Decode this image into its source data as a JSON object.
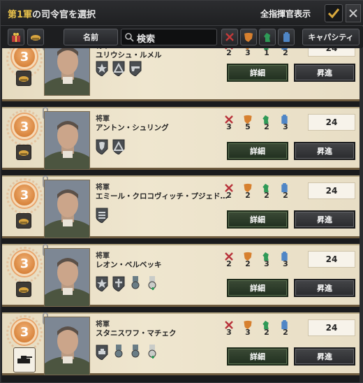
{
  "header": {
    "title_army": "第1軍",
    "title_rest": "の司令官を選択",
    "show_all_label": "全指揮官表示"
  },
  "toolbar": {
    "name_label": "名前",
    "search_placeholder": "検索",
    "capacity_label": "キャパシティ"
  },
  "colors": {
    "attack": "#b8323a",
    "defense": "#d7802f",
    "planning": "#2f9a57",
    "logistics": "#4f86c6",
    "accent": "#e8c14b"
  },
  "commanders": [
    {
      "skill": "3",
      "rank": "将軍",
      "name": "ユリウシュ・ルメル",
      "attack": "2",
      "defense": "3",
      "planning": "1",
      "logistics": "2",
      "capacity": "24",
      "detail": "詳細",
      "promote": "昇進",
      "traits": [
        "star-trait-icon",
        "mountain-trait-icon",
        "gun-trait-icon"
      ]
    },
    {
      "skill": "3",
      "rank": "将軍",
      "name": "アントン・シュリング",
      "attack": "3",
      "defense": "5",
      "planning": "2",
      "logistics": "3",
      "capacity": "24",
      "detail": "詳細",
      "promote": "昇進",
      "traits": [
        "shield-trait-icon",
        "mountain-trait-icon"
      ]
    },
    {
      "skill": "3",
      "rank": "将軍",
      "name": "エミール・クロコヴィッチ・プジェド…",
      "attack": "2",
      "defense": "2",
      "planning": "2",
      "logistics": "2",
      "capacity": "24",
      "detail": "詳細",
      "promote": "昇進",
      "traits": [
        "stripes-trait-icon"
      ]
    },
    {
      "skill": "3",
      "rank": "将軍",
      "name": "レオン・ベルベッキ",
      "attack": "2",
      "defense": "2",
      "planning": "3",
      "logistics": "3",
      "capacity": "24",
      "detail": "詳細",
      "promote": "昇進",
      "traits": [
        "star-trait-icon",
        "cross-trait-icon",
        "medal-trait-icon",
        "medal-add-icon"
      ]
    },
    {
      "skill": "3",
      "rank": "将軍",
      "name": "スタニスワフ・マチェク",
      "attack": "3",
      "defense": "3",
      "planning": "2",
      "logistics": "2",
      "capacity": "24",
      "detail": "詳細",
      "promote": "昇進",
      "traits": [
        "panzer-trait-icon",
        "medal-trait-icon",
        "medal-trait-icon",
        "medal-add-icon"
      ]
    }
  ]
}
